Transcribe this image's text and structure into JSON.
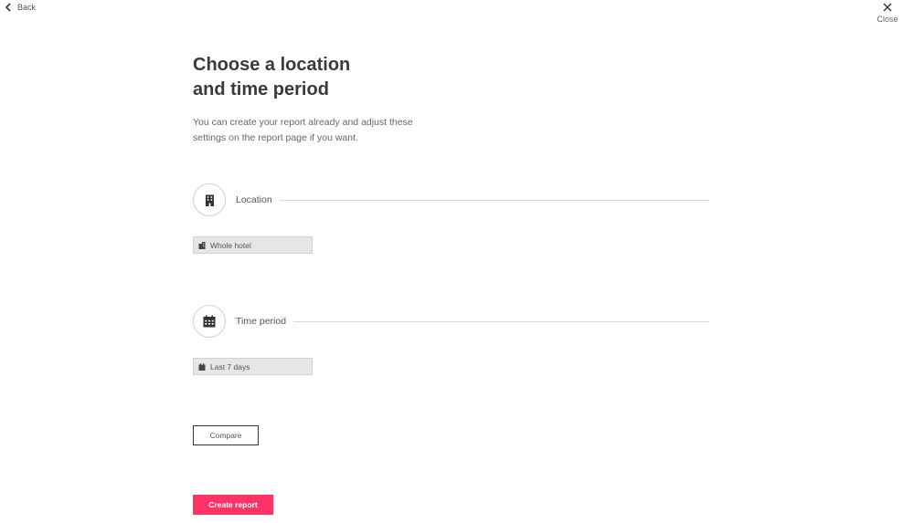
{
  "nav": {
    "back_label": "Back",
    "close_label": "Close"
  },
  "header": {
    "title_line1": "Choose a location",
    "title_line2": "and time period",
    "subtitle_line1": "You can create your report already and adjust these",
    "subtitle_line2": "settings on the report page if you want."
  },
  "location": {
    "label": "Location",
    "icon": "building-icon",
    "selected": "Whole hotel"
  },
  "time_period": {
    "label": "Time period",
    "icon": "calendar-icon",
    "selected": "Last 7 days"
  },
  "actions": {
    "compare_label": "Compare",
    "create_label": "Create report"
  },
  "colors": {
    "accent": "#ff3366",
    "text": "#3a3a3a",
    "chip_bg": "#e6e6e6"
  }
}
